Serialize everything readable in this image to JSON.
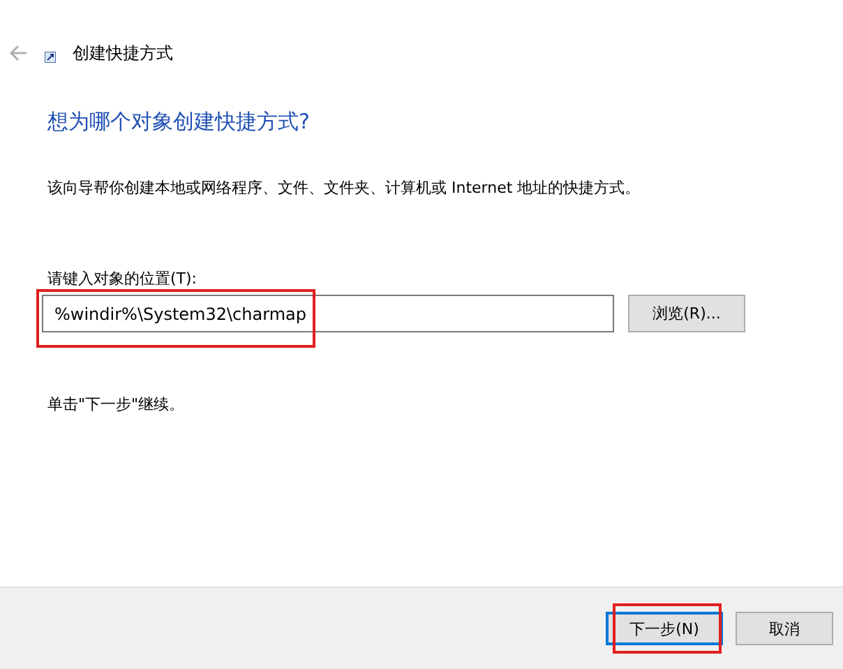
{
  "window": {
    "title": "创建快捷方式"
  },
  "heading": "想为哪个对象创建快捷方式?",
  "description": "该向导帮你创建本地或网络程序、文件、文件夹、计算机或 Internet 地址的快捷方式。",
  "location": {
    "label": "请键入对象的位置(T):",
    "value": "%windir%\\System32\\charmap",
    "highlighted": true
  },
  "browse_button": "浏览(R)...",
  "hint": "单击\"下一步\"继续。",
  "buttons": [
    {
      "label": "下一步(N)",
      "kind": "primary",
      "highlighted": true
    },
    {
      "label": "取消",
      "kind": "normal",
      "highlighted": false
    }
  ]
}
